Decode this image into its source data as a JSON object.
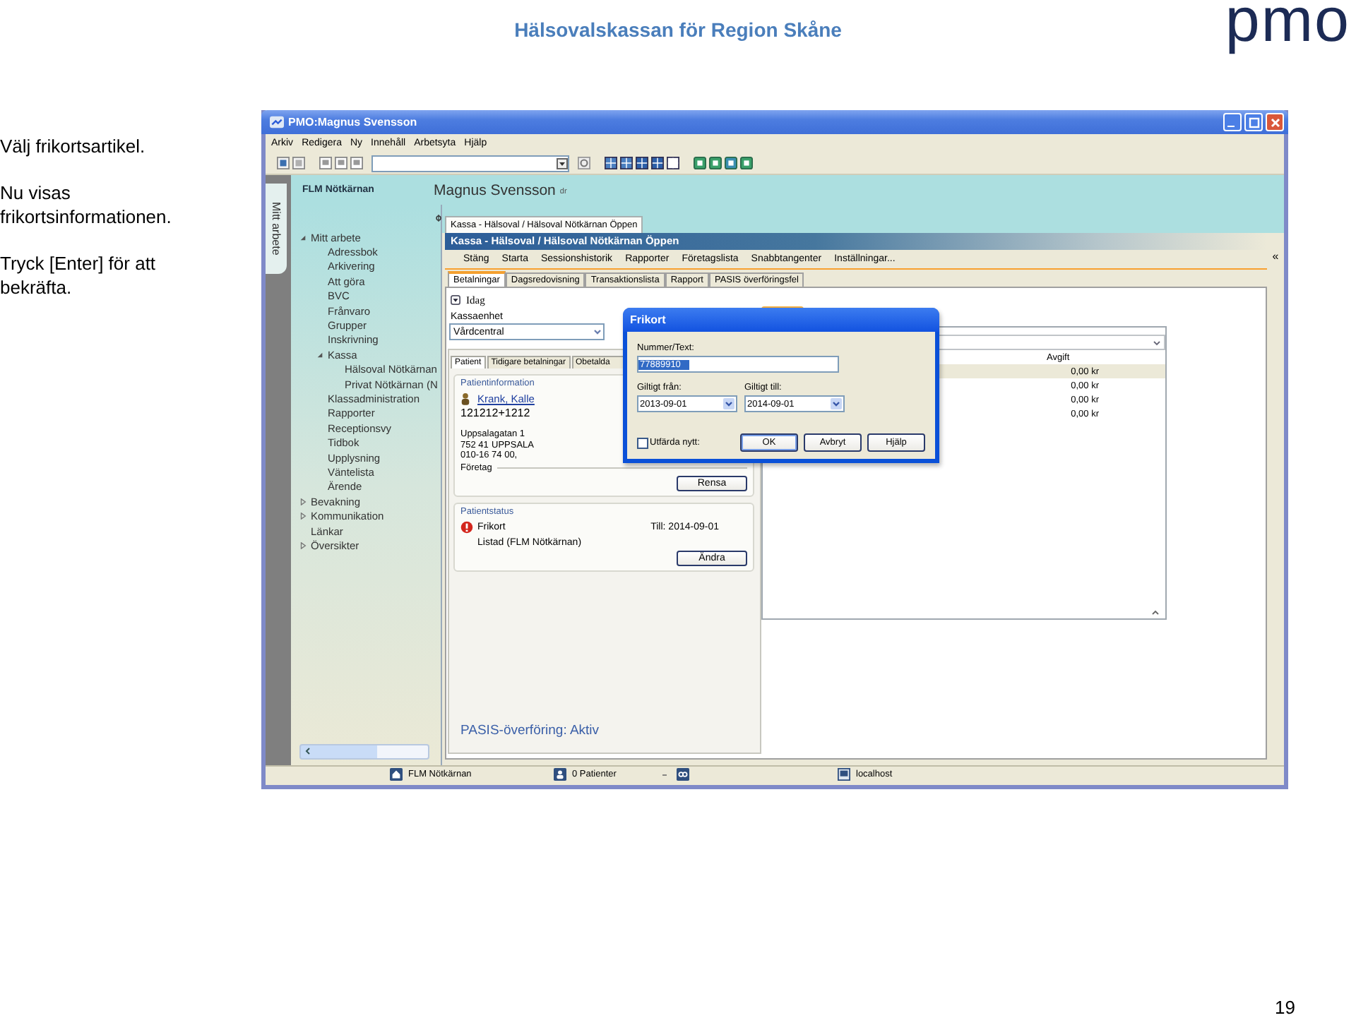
{
  "slide": {
    "title": "Hälsovalskassan för Region Skåne",
    "logo": "pmo",
    "instructions": [
      "Välj frikortsartikel.",
      "Nu visas frikortsinformationen.",
      "Tryck [Enter] för att bekräfta."
    ],
    "page_number": "19"
  },
  "window": {
    "title": "PMO:Magnus Svensson"
  },
  "menu": [
    "Arkiv",
    "Redigera",
    "Ny",
    "Innehåll",
    "Arbetsyta",
    "Hjälp"
  ],
  "side_tab": {
    "label": "Mitt arbete"
  },
  "header": {
    "unit": "FLM Nötkärnan",
    "user": "Magnus Svensson",
    "user_suffix": "dr"
  },
  "nav": {
    "items": [
      {
        "label": "Mitt arbete",
        "expanded": true,
        "children": [
          {
            "label": "Adressbok"
          },
          {
            "label": "Arkivering"
          },
          {
            "label": "Att göra"
          },
          {
            "label": "BVC"
          },
          {
            "label": "Frånvaro"
          },
          {
            "label": "Grupper"
          },
          {
            "label": "Inskrivning"
          },
          {
            "label": "Kassa",
            "expanded": true,
            "children": [
              {
                "label": "Hälsoval Nötkärnan"
              },
              {
                "label": "Privat Nötkärnan (N"
              }
            ]
          },
          {
            "label": "Klassadministration"
          },
          {
            "label": "Rapporter"
          },
          {
            "label": "Receptionsvy"
          },
          {
            "label": "Tidbok"
          },
          {
            "label": "Upplysning"
          },
          {
            "label": "Väntelista"
          },
          {
            "label": "Ärende"
          }
        ]
      },
      {
        "label": "Bevakning",
        "expanded": false
      },
      {
        "label": "Kommunikation",
        "expanded": false
      },
      {
        "label": "Länkar"
      },
      {
        "label": "Översikter",
        "expanded": false
      }
    ]
  },
  "document_tab": "Kassa - Hälsoval / Hälsoval Nötkärnan Öppen",
  "panel": {
    "title": "Kassa - Hälsoval / Hälsoval Nötkärnan Öppen",
    "menu": [
      "Stäng",
      "Starta",
      "Sessionshistorik",
      "Rapporter",
      "Företagslista",
      "Snabbtangenter",
      "Inställningar..."
    ],
    "tabs": [
      {
        "label": "Betalningar",
        "selected": true
      },
      {
        "label": "Dagsredovisning",
        "selected": false
      },
      {
        "label": "Transaktionslista",
        "selected": false
      },
      {
        "label": "Rapport",
        "selected": false
      },
      {
        "label": "PASIS överföringsfel",
        "selected": false
      }
    ],
    "collapse": "«"
  },
  "today": {
    "label": "Idag"
  },
  "cash_unit": {
    "label": "Kassaenhet",
    "value": "Vårdcentral"
  },
  "patient_tabs": [
    {
      "label": "Patient",
      "selected": true
    },
    {
      "label": "Tidigare betalningar",
      "selected": false
    },
    {
      "label": "Obetalda",
      "selected": false
    }
  ],
  "patient_info": {
    "legend": "Patientinformation",
    "name": "Krank, Kalle",
    "id": "121212+1212",
    "street": "Uppsalagatan 1",
    "postcode": "752 41",
    "city": "UPPSALA",
    "phone": "010-16 74 00,",
    "company_label": "Företag",
    "button": "Rensa"
  },
  "patient_status": {
    "legend": "Patientstatus",
    "status": "Frikort",
    "valid_to": "Till: 2014-09-01",
    "listing": "Listad (FLM Nötkärnan)",
    "button": "Ändra"
  },
  "pasis_status": "PASIS-överföring: Aktiv",
  "fees_table": {
    "columns": [
      "Avgift"
    ],
    "rows": [
      {
        "avgift": "0,00 kr",
        "selected": true
      },
      {
        "avgift": "0,00 kr",
        "selected": false
      },
      {
        "avgift": "0,00 kr",
        "selected": false
      },
      {
        "avgift": "0,00 kr",
        "selected": false
      }
    ]
  },
  "dialog": {
    "title": "Frikort",
    "number_label": "Nummer/Text:",
    "number_value": "77889910",
    "from_label": "Giltigt från:",
    "from_value": "2013-09-01",
    "to_label": "Giltigt till:",
    "to_value": "2014-09-01",
    "renew": {
      "label": "Utfärda nytt:",
      "checked": false
    },
    "buttons": [
      {
        "label": "OK",
        "default": true
      },
      {
        "label": "Avbryt",
        "default": false
      },
      {
        "label": "Hjälp",
        "default": false
      }
    ]
  },
  "status_bar": [
    {
      "kind": "home",
      "text": "FLM Nötkärnan"
    },
    {
      "kind": "person",
      "text": "0 Patienter"
    },
    {
      "kind": "link"
    },
    {
      "kind": "computer",
      "text": "localhost"
    }
  ]
}
